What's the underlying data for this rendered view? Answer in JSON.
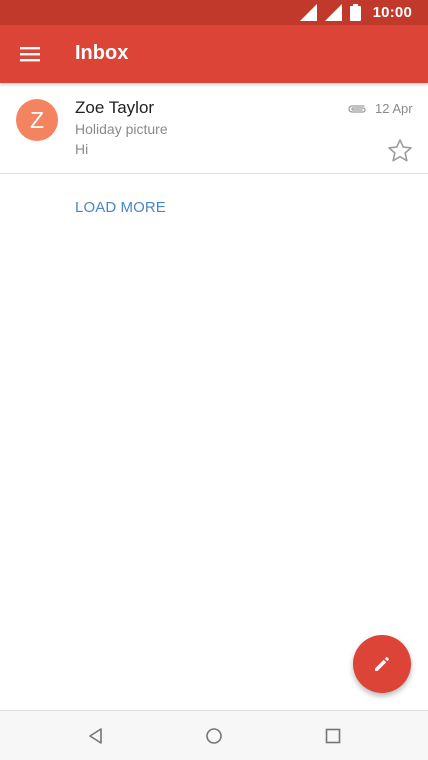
{
  "status_bar": {
    "time": "10:00",
    "icons": [
      "wifi-signal-icon",
      "cell-signal-icon",
      "battery-icon"
    ]
  },
  "app_bar": {
    "title": "Inbox",
    "menu_icon": "hamburger-menu-icon"
  },
  "messages": [
    {
      "avatar_letter": "Z",
      "sender": "Zoe Taylor",
      "subject": "Holiday picture",
      "snippet": "Hi",
      "date": "12 Apr",
      "has_attachment": true,
      "starred": false
    }
  ],
  "load_more_label": "LOAD MORE",
  "fab_icon": "pencil-icon",
  "nav_bar": {
    "icons": [
      "back-icon",
      "home-icon",
      "recents-icon"
    ]
  },
  "colors": {
    "status_bar": "#c0392b",
    "app_bar": "#db4437",
    "avatar": "#f4845f",
    "link": "#4a86c8",
    "fab": "#db4437"
  }
}
